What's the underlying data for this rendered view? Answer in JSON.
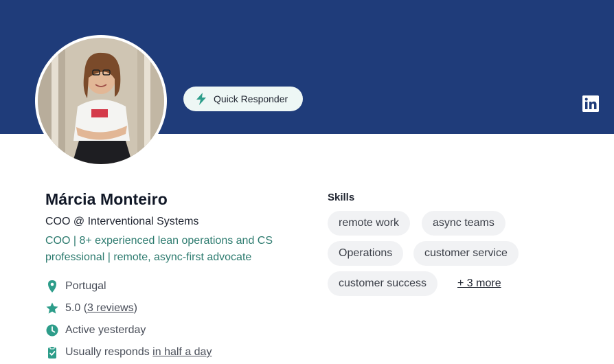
{
  "profile": {
    "name": "Márcia Monteiro",
    "role": "COO @ Interventional Systems",
    "bio": "COO | 8+ experienced lean operations and CS professional | remote, async-first advocate",
    "badge": "Quick Responder",
    "avatar_alt": "Profile photo"
  },
  "meta": {
    "location": "Portugal",
    "rating": "5.0",
    "rating_open": "(",
    "reviews": "3 reviews",
    "rating_close": ")",
    "activity": "Active yesterday",
    "responds_prefix": "Usually responds ",
    "responds_time": "in half a day"
  },
  "skills": {
    "title": "Skills",
    "chips": [
      "remote work",
      "async teams",
      "Operations",
      "customer service",
      "customer success"
    ],
    "more": "+ 3 more"
  },
  "colors": {
    "banner": "#1f3c7a",
    "accent": "#2d9d8a",
    "bio_text": "#2d7b6f",
    "chip_bg": "#f1f2f4"
  },
  "icons": {
    "badge": "lightning-bolt-icon",
    "social": "linkedin-icon",
    "location": "map-pin-icon",
    "rating": "star-icon",
    "activity": "clock-icon",
    "responds": "clipboard-check-icon"
  }
}
